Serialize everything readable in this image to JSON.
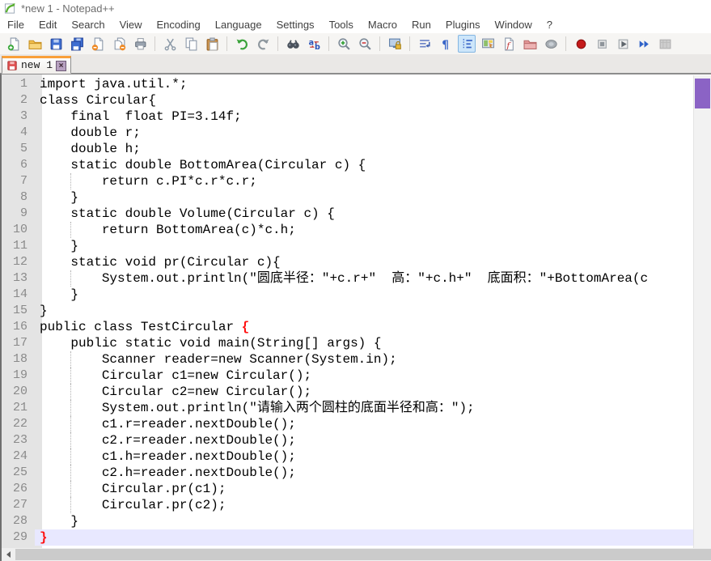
{
  "window": {
    "title": "*new 1 - Notepad++"
  },
  "menu": {
    "items": [
      "File",
      "Edit",
      "Search",
      "View",
      "Encoding",
      "Language",
      "Settings",
      "Tools",
      "Macro",
      "Run",
      "Plugins",
      "Window",
      "?"
    ]
  },
  "toolbar": {
    "groups": [
      {
        "items": [
          {
            "name": "new-document"
          },
          {
            "name": "open-file"
          },
          {
            "name": "save"
          },
          {
            "name": "save-all"
          },
          {
            "name": "close-file"
          },
          {
            "name": "close-all-files"
          },
          {
            "name": "print"
          }
        ]
      },
      {
        "items": [
          {
            "name": "cut"
          },
          {
            "name": "copy"
          },
          {
            "name": "paste"
          }
        ]
      },
      {
        "items": [
          {
            "name": "undo"
          },
          {
            "name": "redo"
          }
        ]
      },
      {
        "items": [
          {
            "name": "find"
          },
          {
            "name": "replace"
          }
        ]
      },
      {
        "items": [
          {
            "name": "zoom-in"
          },
          {
            "name": "zoom-out"
          }
        ]
      },
      {
        "items": [
          {
            "name": "sync-scrolling"
          }
        ]
      },
      {
        "items": [
          {
            "name": "word-wrap"
          },
          {
            "name": "show-all-characters"
          },
          {
            "name": "show-indent-guide",
            "active": true
          },
          {
            "name": "document-map"
          },
          {
            "name": "function-list"
          },
          {
            "name": "folder-as-workspace"
          },
          {
            "name": "monitoring"
          }
        ]
      },
      {
        "items": [
          {
            "name": "record-macro"
          },
          {
            "name": "stop-macro"
          },
          {
            "name": "playback-macro"
          },
          {
            "name": "run-macro-multiple"
          },
          {
            "name": "save-macro",
            "disabled": true
          }
        ]
      }
    ]
  },
  "tabbar": {
    "tabs": [
      {
        "label": "new 1",
        "modified": true,
        "active": true,
        "close_glyph": "×"
      }
    ]
  },
  "editor": {
    "lines": [
      {
        "n": 1,
        "segs": [
          {
            "t": "import java.util.*;"
          }
        ]
      },
      {
        "n": 2,
        "segs": [
          {
            "t": "class Circular{"
          }
        ]
      },
      {
        "n": 3,
        "segs": [
          {
            "t": "    final  float PI=3.14f;"
          }
        ]
      },
      {
        "n": 4,
        "segs": [
          {
            "t": "    double r;"
          }
        ]
      },
      {
        "n": 5,
        "segs": [
          {
            "t": "    double h;"
          }
        ]
      },
      {
        "n": 6,
        "segs": [
          {
            "t": "    static double BottomArea(Circular c) {"
          }
        ]
      },
      {
        "n": 7,
        "g": true,
        "segs": [
          {
            "t": "        return c.PI*c.r*c.r;"
          }
        ]
      },
      {
        "n": 8,
        "segs": [
          {
            "t": "    }"
          }
        ]
      },
      {
        "n": 9,
        "segs": [
          {
            "t": "    static double Volume(Circular c) {"
          }
        ]
      },
      {
        "n": 10,
        "g": true,
        "segs": [
          {
            "t": "        return BottomArea(c)*c.h;"
          }
        ]
      },
      {
        "n": 11,
        "segs": [
          {
            "t": "    }"
          }
        ]
      },
      {
        "n": 12,
        "segs": [
          {
            "t": "    static void pr(Circular c){"
          }
        ]
      },
      {
        "n": 13,
        "g": true,
        "segs": [
          {
            "t": "        System.out.println(\"圆底半径：\"+c.r+\"  高：\"+c.h+\"  底面积：\"+BottomArea(c"
          }
        ]
      },
      {
        "n": 14,
        "segs": [
          {
            "t": "    }"
          }
        ]
      },
      {
        "n": 15,
        "segs": [
          {
            "t": "}"
          }
        ]
      },
      {
        "n": 16,
        "segs": [
          {
            "t": "public class TestCircular "
          },
          {
            "t": "{",
            "c": "b"
          }
        ]
      },
      {
        "n": 17,
        "segs": [
          {
            "t": "    public static void main(String[] args) {"
          }
        ]
      },
      {
        "n": 18,
        "g": true,
        "segs": [
          {
            "t": "        Scanner reader=new Scanner(System.in);"
          }
        ]
      },
      {
        "n": 19,
        "g": true,
        "segs": [
          {
            "t": "        Circular c1=new Circular();"
          }
        ]
      },
      {
        "n": 20,
        "g": true,
        "segs": [
          {
            "t": "        Circular c2=new Circular();"
          }
        ]
      },
      {
        "n": 21,
        "g": true,
        "segs": [
          {
            "t": "        System.out.println(\"请输入两个圆柱的底面半径和高：\");"
          }
        ]
      },
      {
        "n": 22,
        "g": true,
        "segs": [
          {
            "t": "        c1.r=reader.nextDouble();"
          }
        ]
      },
      {
        "n": 23,
        "g": true,
        "segs": [
          {
            "t": "        c2.r=reader.nextDouble();"
          }
        ]
      },
      {
        "n": 24,
        "g": true,
        "segs": [
          {
            "t": "        c1.h=reader.nextDouble();"
          }
        ]
      },
      {
        "n": 25,
        "g": true,
        "segs": [
          {
            "t": "        c2.h=reader.nextDouble();"
          }
        ]
      },
      {
        "n": 26,
        "g": true,
        "segs": [
          {
            "t": "        Circular.pr(c1);"
          }
        ]
      },
      {
        "n": 27,
        "g": true,
        "segs": [
          {
            "t": "        Circular.pr(c2);"
          }
        ]
      },
      {
        "n": 28,
        "segs": [
          {
            "t": "    }"
          }
        ]
      },
      {
        "n": 29,
        "hl": true,
        "segs": [
          {
            "t": "}",
            "c": "b"
          }
        ]
      }
    ]
  },
  "colors": {
    "accent_orange": "#f9a03a",
    "brace_red": "#ff1010",
    "current_line": "#e8e8ff",
    "scroll_thumb_purple": "#8b63c5",
    "gutter_bg": "#e4e4e4",
    "gutter_text": "#8a8a8a"
  }
}
